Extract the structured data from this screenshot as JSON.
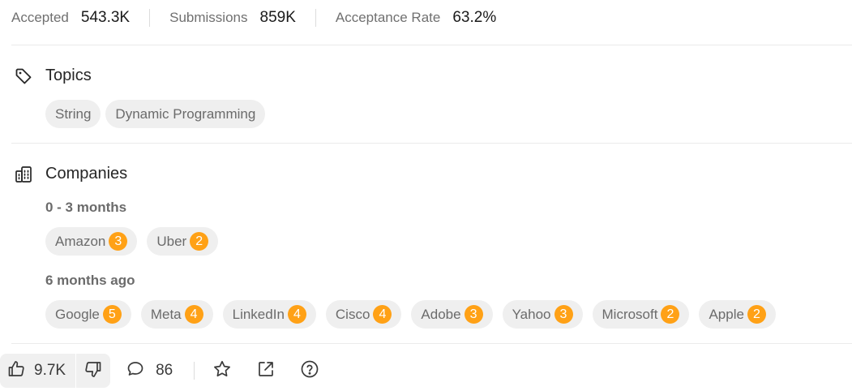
{
  "stats": {
    "accepted_label": "Accepted",
    "accepted_value": "543.3K",
    "submissions_label": "Submissions",
    "submissions_value": "859K",
    "rate_label": "Acceptance Rate",
    "rate_value": "63.2%"
  },
  "topics": {
    "title": "Topics",
    "icon": "tag-icon",
    "items": [
      "String",
      "Dynamic Programming"
    ]
  },
  "companies": {
    "title": "Companies",
    "icon": "building-icon",
    "groups": [
      {
        "label": "0 - 3 months",
        "items": [
          {
            "name": "Amazon",
            "count": "3"
          },
          {
            "name": "Uber",
            "count": "2"
          }
        ]
      },
      {
        "label": "6 months ago",
        "items": [
          {
            "name": "Google",
            "count": "5"
          },
          {
            "name": "Meta",
            "count": "4"
          },
          {
            "name": "LinkedIn",
            "count": "4"
          },
          {
            "name": "Cisco",
            "count": "4"
          },
          {
            "name": "Adobe",
            "count": "3"
          },
          {
            "name": "Yahoo",
            "count": "3"
          },
          {
            "name": "Microsoft",
            "count": "2"
          },
          {
            "name": "Apple",
            "count": "2"
          }
        ]
      }
    ]
  },
  "footer": {
    "likes": "9.7K",
    "comments": "86",
    "icons": [
      "thumbs-up-icon",
      "thumbs-down-icon",
      "comment-icon",
      "star-icon",
      "share-icon",
      "help-icon"
    ]
  },
  "colors": {
    "badge": "#ffa116",
    "chip_bg": "#efefef",
    "muted_text": "#6b6b6b"
  }
}
